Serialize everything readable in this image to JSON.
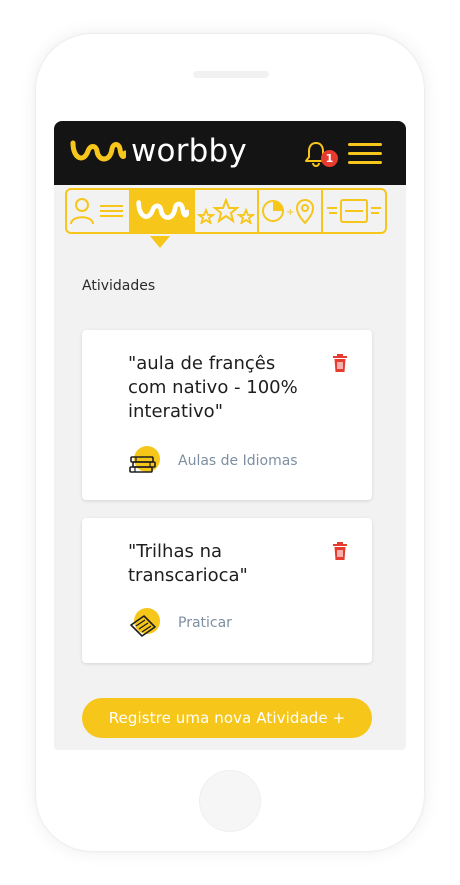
{
  "app": {
    "brand_name": "worbby",
    "notification_count": "1"
  },
  "colors": {
    "accent": "#f7c61a",
    "topbar": "#141414",
    "badge": "#e63b2e",
    "delete": "#e63b2e",
    "category_text": "#7d8fa0"
  },
  "tabs": [
    {
      "icon": "profile-list-icon",
      "active": false
    },
    {
      "icon": "worbby-logo-icon",
      "active": true
    },
    {
      "icon": "stars-icon",
      "active": false
    },
    {
      "icon": "clock-location-icon",
      "active": false
    },
    {
      "icon": "documents-icon",
      "active": false
    }
  ],
  "main": {
    "section_title": "Atividades",
    "activities": [
      {
        "title_lines": [
          "\"aula de françês",
          "com nativo - 100%",
          "interativo\""
        ],
        "category": "Aulas de Idiomas",
        "category_icon": "language-books-icon"
      },
      {
        "title_lines": [
          "\"Trilhas na",
          "transcarioca\""
        ],
        "category": "Praticar",
        "category_icon": "practice-ticket-icon"
      }
    ],
    "cta_label": "Registre uma nova Atividade +"
  }
}
